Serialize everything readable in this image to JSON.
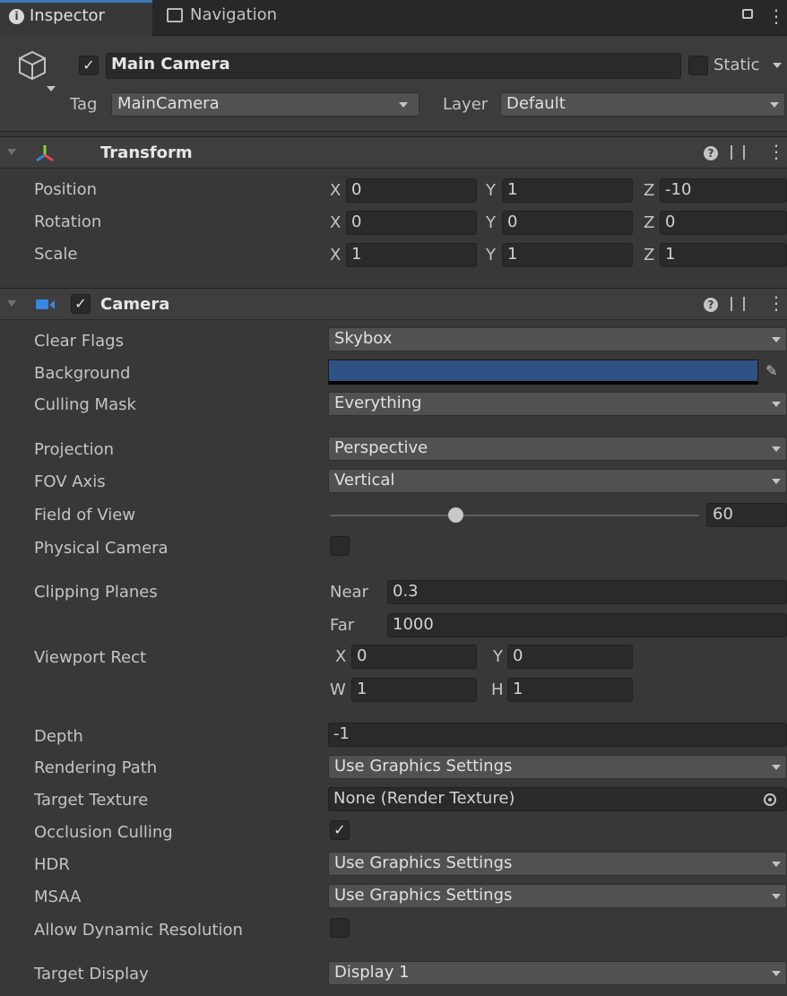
{
  "tabs": [
    {
      "label": "Inspector",
      "icon": "info-icon"
    },
    {
      "label": "Navigation",
      "icon": "navigation-icon"
    }
  ],
  "object": {
    "name": "Main Camera",
    "active": true,
    "static_label": "Static",
    "tag_label": "Tag",
    "tag_value": "MainCamera",
    "layer_label": "Layer",
    "layer_value": "Default"
  },
  "transform": {
    "title": "Transform",
    "rows": [
      {
        "label": "Position",
        "x": "0",
        "y": "1",
        "z": "-10"
      },
      {
        "label": "Rotation",
        "x": "0",
        "y": "0",
        "z": "0"
      },
      {
        "label": "Scale",
        "x": "1",
        "y": "1",
        "z": "1"
      }
    ],
    "axis_x": "X",
    "axis_y": "Y",
    "axis_z": "Z"
  },
  "camera": {
    "title": "Camera",
    "enabled": true,
    "clear_flags_label": "Clear Flags",
    "clear_flags_value": "Skybox",
    "background_label": "Background",
    "background_color": "#2f5286",
    "culling_mask_label": "Culling Mask",
    "culling_mask_value": "Everything",
    "projection_label": "Projection",
    "projection_value": "Perspective",
    "fov_axis_label": "FOV Axis",
    "fov_axis_value": "Vertical",
    "fov_label": "Field of View",
    "fov_value": "60",
    "fov_slider_fraction": 0.34,
    "physical_camera_label": "Physical Camera",
    "physical_camera_checked": false,
    "clipping_label": "Clipping Planes",
    "near_label": "Near",
    "near_value": "0.3",
    "far_label": "Far",
    "far_value": "1000",
    "viewport_label": "Viewport Rect",
    "vp_x_label": "X",
    "vp_x": "0",
    "vp_y_label": "Y",
    "vp_y": "0",
    "vp_w_label": "W",
    "vp_w": "1",
    "vp_h_label": "H",
    "vp_h": "1",
    "depth_label": "Depth",
    "depth_value": "-1",
    "rendering_path_label": "Rendering Path",
    "rendering_path_value": "Use Graphics Settings",
    "target_texture_label": "Target Texture",
    "target_texture_value": "None (Render Texture)",
    "occlusion_label": "Occlusion Culling",
    "occlusion_checked": true,
    "hdr_label": "HDR",
    "hdr_value": "Use Graphics Settings",
    "msaa_label": "MSAA",
    "msaa_value": "Use Graphics Settings",
    "dyn_res_label": "Allow Dynamic Resolution",
    "dyn_res_checked": false,
    "target_display_label": "Target Display",
    "target_display_value": "Display 1"
  },
  "glyphs": {
    "check": "✓",
    "help": "?",
    "more": "⋮",
    "lock": "🔓"
  }
}
